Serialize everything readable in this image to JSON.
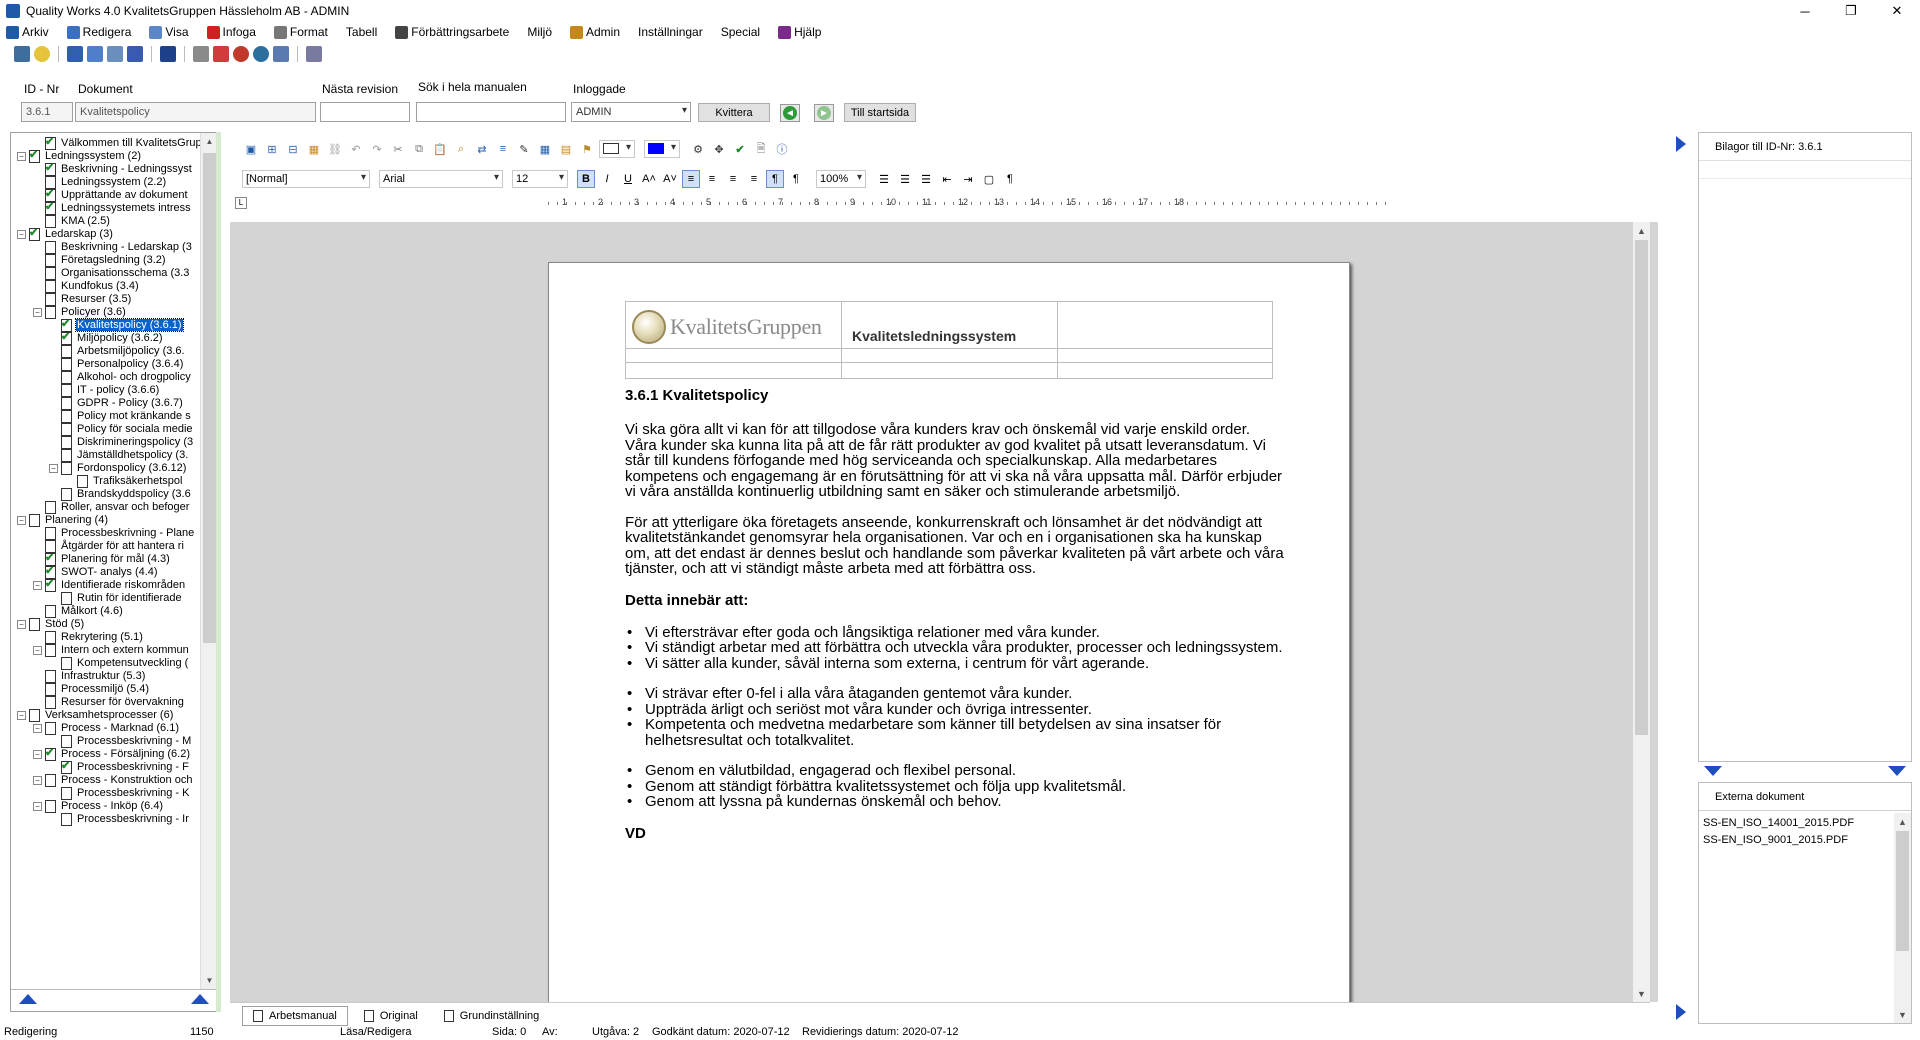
{
  "window": {
    "title": "Quality Works 4.0 KvalitetsGruppen Hässleholm AB - ADMIN",
    "minimize": "─",
    "maximize": "❐",
    "close": "✕"
  },
  "menu": [
    {
      "label": "Arkiv",
      "icon": "save-icon",
      "color": "#1e5aa8"
    },
    {
      "label": "Redigera",
      "icon": "edit-icon",
      "color": "#3a6fc4"
    },
    {
      "label": "Visa",
      "icon": "view-icon",
      "color": "#5b87c9"
    },
    {
      "label": "Infoga",
      "icon": "insert-icon",
      "color": "#d02020"
    },
    {
      "label": "Format",
      "icon": "format-icon",
      "color": "#777777"
    },
    {
      "label": "Tabell",
      "icon": "",
      "color": ""
    },
    {
      "label": "Förbättringsarbete",
      "icon": "improvement-icon",
      "color": "#444444"
    },
    {
      "label": "Miljö",
      "icon": "",
      "color": ""
    },
    {
      "label": "Admin",
      "icon": "admin-icon",
      "color": "#c8871b"
    },
    {
      "label": "Inställningar",
      "icon": "",
      "color": ""
    },
    {
      "label": "Special",
      "icon": "",
      "color": ""
    },
    {
      "label": "Hjälp",
      "icon": "help-icon",
      "color": "#7a2a8a"
    }
  ],
  "fields": {
    "id_label": "ID - Nr",
    "id_value": "3.6.1",
    "doc_label": "Dokument",
    "doc_value": "Kvalitetspolicy",
    "next_rev_label": "Nästa revision",
    "next_rev_value": "",
    "search_label": "Sök i hela manualen",
    "search_value": "",
    "logged_label": "Inloggade",
    "logged_value": "ADMIN",
    "kvittera": "Kvittera",
    "till_startsida": "Till startsida",
    "back_arrow": "◄",
    "fwd_arrow": "►"
  },
  "tree": [
    {
      "indent": 1,
      "text": "Välkommen till KvalitetsGruppe",
      "check": true,
      "exp": ""
    },
    {
      "indent": 0,
      "text": "Ledningssystem (2)",
      "check": true,
      "exp": "−"
    },
    {
      "indent": 1,
      "text": "Beskrivning - Ledningssyst",
      "check": true,
      "exp": ""
    },
    {
      "indent": 1,
      "text": "Ledningssystem (2.2)",
      "check": false,
      "exp": ""
    },
    {
      "indent": 1,
      "text": "Upprättande av dokument",
      "check": true,
      "exp": ""
    },
    {
      "indent": 1,
      "text": "Ledningssystemets intress",
      "check": true,
      "exp": ""
    },
    {
      "indent": 1,
      "text": "KMA (2.5)",
      "check": false,
      "exp": ""
    },
    {
      "indent": 0,
      "text": "Ledarskap (3)",
      "check": true,
      "exp": "−"
    },
    {
      "indent": 1,
      "text": "Beskrivning - Ledarskap (3",
      "check": false,
      "exp": ""
    },
    {
      "indent": 1,
      "text": "Företagsledning (3.2)",
      "check": false,
      "exp": ""
    },
    {
      "indent": 1,
      "text": "Organisationsschema (3.3",
      "check": false,
      "exp": ""
    },
    {
      "indent": 1,
      "text": "Kundfokus (3.4)",
      "check": false,
      "exp": ""
    },
    {
      "indent": 1,
      "text": "Resurser (3.5)",
      "check": false,
      "exp": ""
    },
    {
      "indent": 1,
      "text": "Policyer (3.6)",
      "check": false,
      "exp": "−"
    },
    {
      "indent": 2,
      "text": "Kvalitetspolicy (3.6.1)",
      "check": true,
      "exp": "",
      "sel": true
    },
    {
      "indent": 2,
      "text": "Miljöpolicy (3.6.2)",
      "check": true,
      "exp": ""
    },
    {
      "indent": 2,
      "text": "Arbetsmiljöpolicy (3.6.",
      "check": false,
      "exp": ""
    },
    {
      "indent": 2,
      "text": "Personalpolicy (3.6.4)",
      "check": false,
      "exp": ""
    },
    {
      "indent": 2,
      "text": "Alkohol- och drogpolicy",
      "check": false,
      "exp": ""
    },
    {
      "indent": 2,
      "text": "IT - policy (3.6.6)",
      "check": false,
      "exp": ""
    },
    {
      "indent": 2,
      "text": "GDPR - Policy (3.6.7)",
      "check": false,
      "exp": ""
    },
    {
      "indent": 2,
      "text": "Policy mot kränkande s",
      "check": false,
      "exp": ""
    },
    {
      "indent": 2,
      "text": "Policy för sociala medie",
      "check": false,
      "exp": ""
    },
    {
      "indent": 2,
      "text": "Diskrimineringspolicy (3",
      "check": false,
      "exp": ""
    },
    {
      "indent": 2,
      "text": "Jämställdhetspolicy (3.",
      "check": false,
      "exp": ""
    },
    {
      "indent": 2,
      "text": "Fordonspolicy (3.6.12)",
      "check": false,
      "exp": "−"
    },
    {
      "indent": 3,
      "text": "Trafiksäkerhetspol",
      "check": false,
      "exp": ""
    },
    {
      "indent": 2,
      "text": "Brandskyddspolicy (3.6",
      "check": false,
      "exp": ""
    },
    {
      "indent": 1,
      "text": "Roller, ansvar och befoger",
      "check": false,
      "exp": ""
    },
    {
      "indent": 0,
      "text": "Planering (4)",
      "check": false,
      "exp": "−"
    },
    {
      "indent": 1,
      "text": "Processbeskrivning - Plane",
      "check": false,
      "exp": ""
    },
    {
      "indent": 1,
      "text": "Åtgärder för att hantera ri",
      "check": false,
      "exp": ""
    },
    {
      "indent": 1,
      "text": "Planering för mål (4.3)",
      "check": true,
      "exp": ""
    },
    {
      "indent": 1,
      "text": "SWOT- analys (4.4)",
      "check": true,
      "exp": ""
    },
    {
      "indent": 1,
      "text": "Identifierade riskområden",
      "check": true,
      "exp": "−"
    },
    {
      "indent": 2,
      "text": "Rutin för identifierade",
      "check": false,
      "exp": ""
    },
    {
      "indent": 1,
      "text": "Målkort (4.6)",
      "check": false,
      "exp": ""
    },
    {
      "indent": 0,
      "text": "Stöd (5)",
      "check": false,
      "exp": "−"
    },
    {
      "indent": 1,
      "text": "Rekrytering (5.1)",
      "check": false,
      "exp": ""
    },
    {
      "indent": 1,
      "text": "Intern och extern kommun",
      "check": false,
      "exp": "−"
    },
    {
      "indent": 2,
      "text": "Kompetensutveckling (",
      "check": false,
      "exp": ""
    },
    {
      "indent": 1,
      "text": "Infrastruktur (5.3)",
      "check": false,
      "exp": ""
    },
    {
      "indent": 1,
      "text": "Processmiljö (5.4)",
      "check": false,
      "exp": ""
    },
    {
      "indent": 1,
      "text": "Resurser för övervakning",
      "check": false,
      "exp": ""
    },
    {
      "indent": 0,
      "text": "Verksamhetsprocesser (6)",
      "check": false,
      "exp": "−"
    },
    {
      "indent": 1,
      "text": "Process - Marknad (6.1)",
      "check": false,
      "exp": "−"
    },
    {
      "indent": 2,
      "text": "Processbeskrivning - M",
      "check": false,
      "exp": ""
    },
    {
      "indent": 1,
      "text": "Process - Försäljning (6.2)",
      "check": true,
      "exp": "−"
    },
    {
      "indent": 2,
      "text": "Processbeskrivning - F",
      "check": true,
      "exp": ""
    },
    {
      "indent": 1,
      "text": "Process - Konstruktion och",
      "check": false,
      "exp": "−"
    },
    {
      "indent": 2,
      "text": "Processbeskrivning - K",
      "check": false,
      "exp": ""
    },
    {
      "indent": 1,
      "text": "Process - Inköp (6.4)",
      "check": false,
      "exp": "−"
    },
    {
      "indent": 2,
      "text": "Processbeskrivning - Ir",
      "check": false,
      "exp": ""
    }
  ],
  "editor": {
    "style": "[Normal]",
    "font": "Arial",
    "size": "12",
    "zoom": "100%",
    "bold": "B",
    "italic": "I",
    "underline": "U",
    "grow": "A˄",
    "shrink": "A˅",
    "pilcrow": "¶",
    "ruler_numbers": [
      "1",
      "2",
      "3",
      "4",
      "5",
      "6",
      "7",
      "8",
      "9",
      "10",
      "11",
      "12",
      "13",
      "14",
      "15",
      "16",
      "17",
      "18"
    ]
  },
  "document": {
    "logo_text": "KvalitetsGruppen",
    "header_title": "Kvalitetsledningssystem",
    "heading": "3.6.1 Kvalitetspolicy",
    "para1": "Vi ska göra allt vi kan för att tillgodose våra kunders krav och önskemål vid varje enskild order. Våra kunder ska kunna lita på att de får rätt produkter av god kvalitet på utsatt leveransdatum. Vi står till kundens förfogande med hög serviceanda och specialkunskap. Alla medarbetares kompetens och engagemang är en förutsättning för att vi ska nå våra uppsatta mål. Därför erbjuder vi våra anställda kontinuerlig utbildning samt en säker och stimulerande arbetsmiljö.",
    "para2": "För att ytterligare öka företagets anseende, konkurrenskraft och lönsamhet är det nödvändigt att kvalitetstänkandet genomsyrar hela organisationen. Var och en i organisationen ska ha kunskap om, att det endast är dennes beslut och handlande som påverkar kvaliteten på vårt arbete och våra tjänster, och att vi ständigt måste arbeta med att förbättra oss.",
    "subheading": "Detta innebär att:",
    "bullets_a": [
      "Vi eftersträvar efter goda och långsiktiga relationer med våra kunder.",
      "Vi ständigt arbetar med att förbättra och utveckla våra produkter, processer och ledningssystem.",
      "Vi sätter alla kunder, såväl interna som externa, i centrum för vårt agerande."
    ],
    "bullets_b": [
      "Vi strävar efter 0-fel i alla våra åtaganden gentemot våra kunder.",
      "Uppträda ärligt och seriöst mot våra kunder och övriga intressenter.",
      "Kompetenta och medvetna medarbetare som känner till betydelsen av sina insatser för  helhetsresultat och totalkvalitet."
    ],
    "bullets_c": [
      "Genom en välutbildad, engagerad och flexibel personal.",
      "Genom att ständigt förbättra kvalitetssystemet och följa upp kvalitetsmål.",
      "Genom att lyssna på kundernas önskemål och behov."
    ],
    "cut_text": "VD"
  },
  "tabs": [
    "Arbetsmanual",
    "Original",
    "Grundinställning"
  ],
  "right_panel": {
    "bilagor": "Bilagor till ID-Nr: 3.6.1",
    "externa": "Externa dokument",
    "files": [
      "SS-EN_ISO_14001_2015.PDF",
      "SS-EN_ISO_9001_2015.PDF"
    ]
  },
  "status": {
    "mode": "Redigering",
    "count": "1150",
    "access": "Läsa/Redigera",
    "sida": "Sida: 0",
    "av": "Av:",
    "utgava": "Utgåva: 2",
    "godkant": "Godkänt datum: 2020-07-12",
    "revision": "Revidierings datum: 2020-07-12"
  },
  "colors": {
    "selection": "#0a64c8",
    "nav_arrow": "#1f4fbf",
    "check": "#1a8a2a",
    "canvas": "#d4d4d4"
  }
}
